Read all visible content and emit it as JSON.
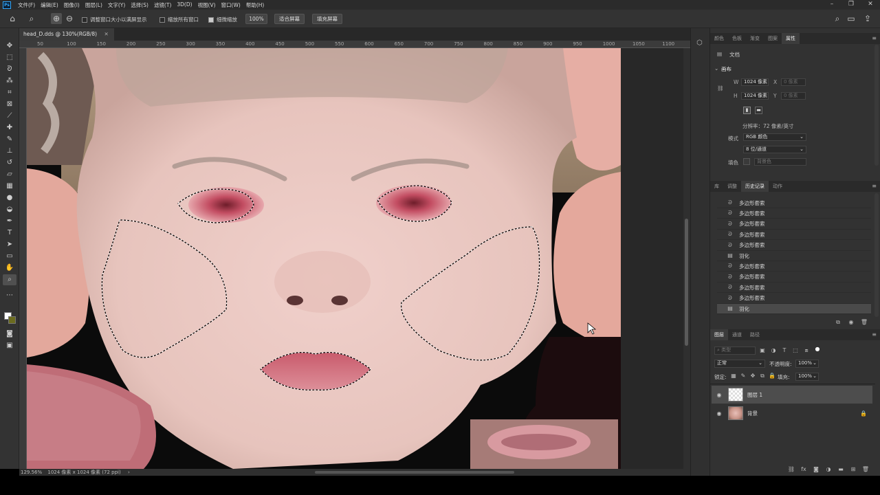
{
  "menu": {
    "app_icon": "Ps",
    "items": [
      "文件(F)",
      "编辑(E)",
      "图像(I)",
      "图层(L)",
      "文字(Y)",
      "选择(S)",
      "滤镜(T)",
      "3D(D)",
      "视图(V)",
      "窗口(W)",
      "帮助(H)"
    ]
  },
  "options_bar": {
    "resize_windows": "调整窗口大小以满屏显示",
    "zoom_all_windows": "缩放所有窗口",
    "scrubby_zoom": "细微缩放",
    "zoom_value": "100%",
    "fit_screen": "适合屏幕",
    "fill_screen": "填充屏幕"
  },
  "document": {
    "tab_title": "head_D.dds @ 130%(RGB/8)",
    "ruler_ticks": [
      "50",
      "100",
      "150",
      "200",
      "250",
      "300",
      "350",
      "400",
      "450",
      "500",
      "550",
      "600",
      "650",
      "700",
      "750",
      "800",
      "850",
      "900",
      "950",
      "1000",
      "1050",
      "1100"
    ],
    "status_zoom": "129.56%",
    "status_info": "1024 像素 x 1024 像素 (72 ppi)"
  },
  "properties_panel": {
    "tabs": [
      "颜色",
      "色板",
      "渐变",
      "图案",
      "属性"
    ],
    "active_tab": "属性",
    "doc_label": "文档",
    "section": "画布",
    "width_label": "W",
    "width_value": "1024 像素",
    "x_label": "X",
    "x_value": "0 像素",
    "height_label": "H",
    "height_value": "1024 像素",
    "y_label": "Y",
    "y_value": "0 像素",
    "resolution": "分辨率：72 像素/英寸",
    "mode_label": "模式",
    "mode_value": "RGB 颜色",
    "depth_value": "8 位/通道",
    "fill_label": "填色",
    "fill_value": "背景色"
  },
  "history_panel": {
    "tabs": [
      "库",
      "调整",
      "历史记录",
      "动作"
    ],
    "active_tab": "历史记录",
    "items": [
      {
        "label": "多边形套索",
        "icon": "lasso-icon",
        "selected": false
      },
      {
        "label": "多边形套索",
        "icon": "lasso-icon",
        "selected": false
      },
      {
        "label": "多边形套索",
        "icon": "lasso-icon",
        "selected": false
      },
      {
        "label": "多边形套索",
        "icon": "lasso-icon",
        "selected": false
      },
      {
        "label": "多边形套索",
        "icon": "lasso-icon",
        "selected": false
      },
      {
        "label": "羽化",
        "icon": "feather-icon",
        "selected": false
      },
      {
        "label": "多边形套索",
        "icon": "lasso-icon",
        "selected": false
      },
      {
        "label": "多边形套索",
        "icon": "lasso-icon",
        "selected": false
      },
      {
        "label": "多边形套索",
        "icon": "lasso-icon",
        "selected": false
      },
      {
        "label": "多边形套索",
        "icon": "lasso-icon",
        "selected": false
      },
      {
        "label": "羽化",
        "icon": "feather-icon",
        "selected": true
      }
    ]
  },
  "layers_panel": {
    "tabs": [
      "图层",
      "通道",
      "路径"
    ],
    "active_tab": "图层",
    "search_placeholder": "类型",
    "blend_mode": "正常",
    "opacity_label": "不透明度:",
    "opacity_value": "100%",
    "lock_label": "锁定:",
    "fill_label": "填充:",
    "fill_value": "100%",
    "layers": [
      {
        "name": "图层 1",
        "selected": true,
        "locked": false
      },
      {
        "name": "背景",
        "selected": false,
        "locked": true
      }
    ]
  },
  "colors": {
    "accent": "#31a8ff",
    "background_swatch": "#6b6b1f",
    "foreground_swatch": "#ffffff"
  }
}
